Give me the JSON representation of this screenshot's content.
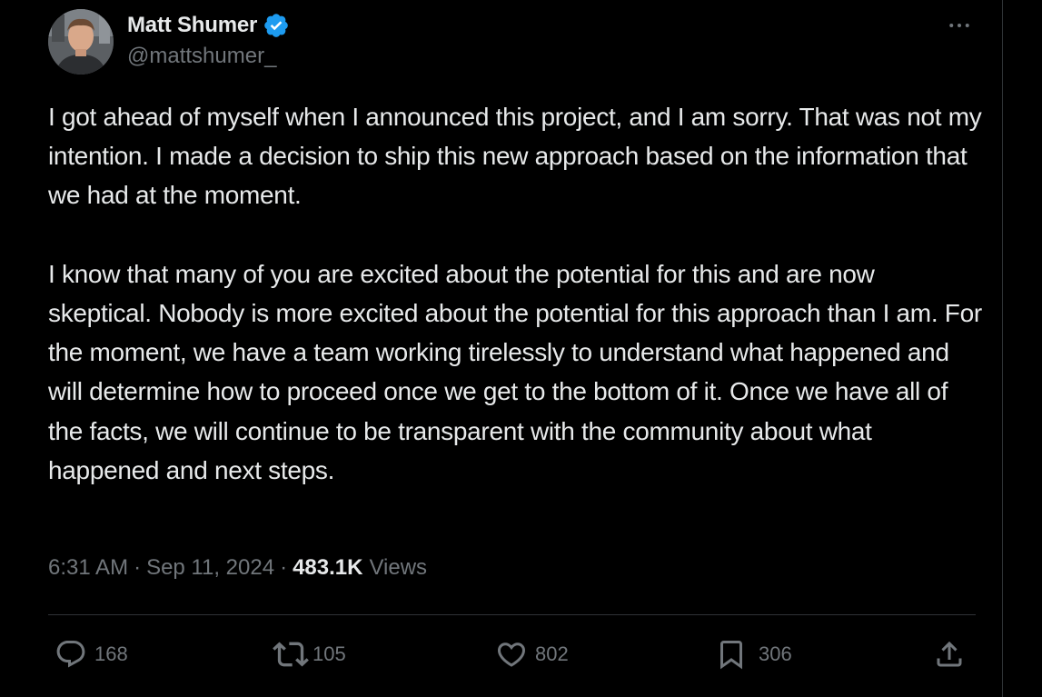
{
  "author": {
    "name": "Matt Shumer",
    "handle": "@mattshumer_",
    "verified": true
  },
  "tweet": {
    "paragraph_1": "I got ahead of myself when I announced this project, and I am sorry. That was not my intention. I made a decision to ship this new approach based on the information that we had at the moment.",
    "paragraph_2": "I know that many of you are excited about the potential for this and are now skeptical. Nobody is more excited about the potential for this approach than I am. For the moment, we have a team working tirelessly to understand what happened and will determine how to proceed once we get to the bottom of it. Once we have all of the facts, we will continue to be transparent with the community about what happened and next steps."
  },
  "meta": {
    "time": "6:31 AM",
    "separator": "·",
    "date": "Sep 11, 2024",
    "views_count": "483.1K",
    "views_label": "Views"
  },
  "actions": {
    "replies": "168",
    "reposts": "105",
    "likes": "802",
    "bookmarks": "306"
  },
  "icons": {
    "verified": "verified-badge-icon",
    "more": "more-horizontal-icon",
    "reply": "reply-icon",
    "repost": "repost-icon",
    "like": "heart-icon",
    "bookmark": "bookmark-icon",
    "share": "share-icon"
  },
  "colors": {
    "background": "#000000",
    "text_primary": "#e7e9ea",
    "text_secondary": "#71767b",
    "verified_blue": "#1d9bf0",
    "border": "#2f3336"
  }
}
